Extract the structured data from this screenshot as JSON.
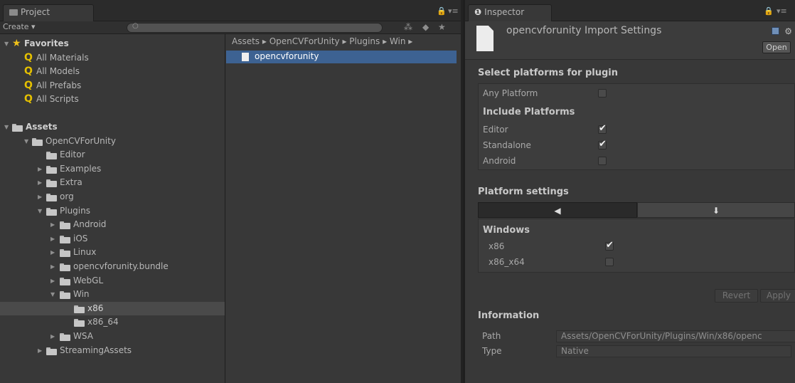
{
  "project": {
    "tab_label": "Project",
    "create_label": "Create ▾",
    "breadcrumb": "Assets ▸ OpenCVForUnity ▸ Plugins ▸ Win ▸",
    "selected_file": "opencvforunity",
    "favorites": {
      "label": "Favorites",
      "items": [
        "All Materials",
        "All Models",
        "All Prefabs",
        "All Scripts"
      ]
    },
    "assets": {
      "label": "Assets",
      "opencv": "OpenCVForUnity",
      "editor": "Editor",
      "examples": "Examples",
      "extra": "Extra",
      "org": "org",
      "plugins": "Plugins",
      "android": "Android",
      "ios": "iOS",
      "linux": "Linux",
      "bundle": "opencvforunity.bundle",
      "webgl": "WebGL",
      "win": "Win",
      "x86": "x86",
      "x86_64": "x86_64",
      "wsa": "WSA",
      "streaming": "StreamingAssets"
    }
  },
  "inspector": {
    "tab_label": "Inspector",
    "title": "opencvforunity Import Settings",
    "open_button": "Open",
    "select_platforms": "Select platforms for plugin",
    "any_platform": "Any Platform",
    "include_platforms": "Include Platforms",
    "editor": "Editor",
    "standalone": "Standalone",
    "android": "Android",
    "platform_settings": "Platform settings",
    "platform_tab_active": "◀",
    "platform_tab_inactive": "⬇",
    "windows": "Windows",
    "x86": "x86",
    "x86_x64": "x86_x64",
    "revert": "Revert",
    "apply": "Apply",
    "information": "Information",
    "path_label": "Path",
    "path_value": "Assets/OpenCVForUnity/Plugins/Win/x86/openc",
    "type_label": "Type",
    "type_value": "Native",
    "checkboxes": {
      "any_platform": false,
      "editor": true,
      "standalone": true,
      "android": false,
      "x86": true,
      "x86_x64": false
    }
  }
}
